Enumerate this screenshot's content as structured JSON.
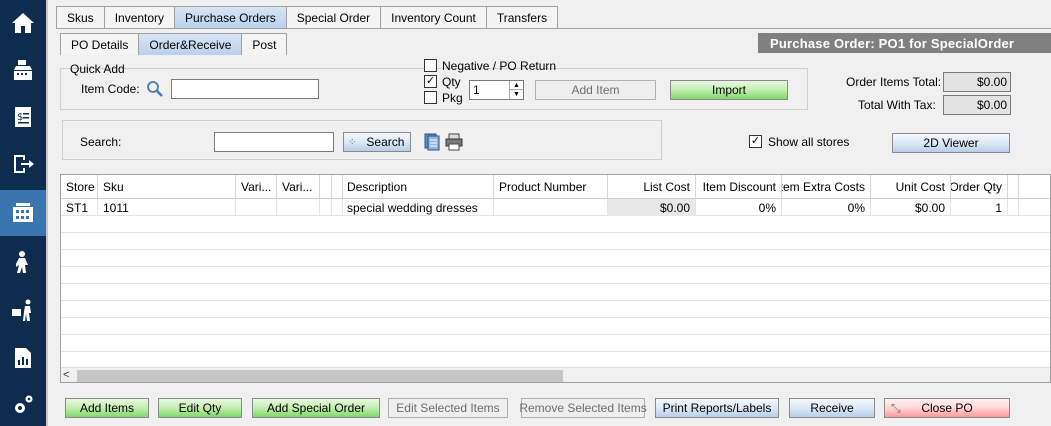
{
  "sidebar": {
    "items": [
      {
        "icon": "home-icon"
      },
      {
        "icon": "cash-register-icon"
      },
      {
        "icon": "receipt-icon"
      },
      {
        "icon": "logout-icon"
      },
      {
        "icon": "inventory-icon",
        "active": true
      },
      {
        "icon": "customer-icon"
      },
      {
        "icon": "delivery-icon"
      },
      {
        "icon": "reports-icon"
      },
      {
        "icon": "settings-icon"
      }
    ]
  },
  "tabs": [
    "Skus",
    "Inventory",
    "Purchase Orders",
    "Special Order",
    "Inventory Count",
    "Transfers"
  ],
  "subtabs": [
    "PO Details",
    "Order&Receive",
    "Post"
  ],
  "po_title": "Purchase Order:  PO1 for SpecialOrder",
  "quick_add": {
    "group_label": "Quick Add",
    "item_code_label": "Item Code:",
    "item_code_value": "",
    "negative_label": "Negative / PO Return",
    "qty_label": "Qty",
    "pkg_label": "Pkg",
    "qty_value": "1",
    "add_item_label": "Add Item",
    "import_label": "Import"
  },
  "totals": {
    "order_items_total_label": "Order Items Total:",
    "order_items_total_value": "$0.00",
    "total_with_tax_label": "Total With Tax:",
    "total_with_tax_value": "$0.00"
  },
  "search": {
    "label": "Search:",
    "value": "",
    "button_label": "Search"
  },
  "show_all_stores_label": "Show all stores",
  "viewer_label": "2D Viewer",
  "grid": {
    "columns": [
      "Store",
      "Sku",
      "Vari...",
      "Vari...",
      "",
      "",
      "Description",
      "Product Number",
      "List Cost",
      "Item Discount",
      "Item Extra Costs",
      "Unit Cost",
      "Order Qty"
    ],
    "rows": [
      [
        "ST1",
        "1011",
        "",
        "",
        "",
        "",
        "special wedding dresses",
        "",
        "$0.00",
        "0%",
        "0%",
        "$0.00",
        "1"
      ]
    ]
  },
  "bottom_buttons": {
    "add_items": "Add Items",
    "edit_qty": "Edit Qty",
    "add_special_order": "Add Special Order",
    "edit_selected": "Edit Selected Items",
    "remove_selected": "Remove Selected Items",
    "print_reports": "Print Reports/Labels",
    "receive": "Receive",
    "close_po": "Close PO"
  }
}
